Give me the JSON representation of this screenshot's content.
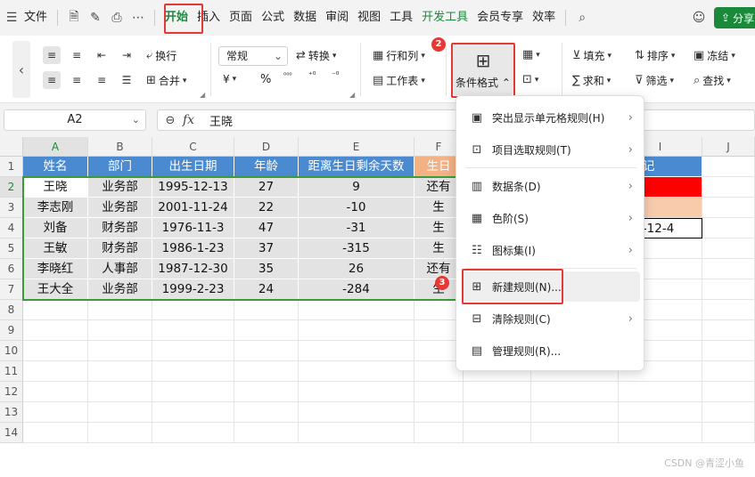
{
  "menubar": {
    "file": "文件",
    "tabs": [
      "开始",
      "插入",
      "页面",
      "公式",
      "数据",
      "审阅",
      "视图",
      "工具",
      "开发工具",
      "会员专享",
      "效率"
    ],
    "share": "分享"
  },
  "ribbon": {
    "wrap": "换行",
    "merge": "合并",
    "number_format": "常规",
    "convert": "转换",
    "rows_cols": "行和列",
    "worksheet": "工作表",
    "cond_format": "条件格式",
    "fill": "填充",
    "sort": "排序",
    "freeze": "冻结",
    "sum": "求和",
    "filter": "筛选",
    "find": "查找",
    "currency": "¥",
    "percent": "%"
  },
  "badges": [
    "1",
    "2",
    "3"
  ],
  "formula_bar": {
    "name_box": "A2",
    "fx": "fx",
    "value": "王晓"
  },
  "columns": [
    "A",
    "B",
    "C",
    "D",
    "E",
    "F",
    "G",
    "H",
    "I",
    "J"
  ],
  "rows": [
    "1",
    "2",
    "3",
    "4",
    "5",
    "6",
    "7",
    "8",
    "9",
    "10",
    "11",
    "12",
    "13",
    "14"
  ],
  "table": {
    "headers": [
      "姓名",
      "部门",
      "出生日期",
      "年龄",
      "距离生日剩余天数",
      "生日"
    ],
    "rows": [
      [
        "王晓",
        "业务部",
        "1995-12-13",
        "27",
        "9",
        "还有"
      ],
      [
        "李志刚",
        "业务部",
        "2001-11-24",
        "22",
        "-10",
        "生"
      ],
      [
        "刘备",
        "财务部",
        "1976-11-3",
        "47",
        "-31",
        "生"
      ],
      [
        "王敏",
        "财务部",
        "1986-1-23",
        "37",
        "-315",
        "生"
      ],
      [
        "李晓红",
        "人事部",
        "1987-12-30",
        "35",
        "26",
        "还有"
      ],
      [
        "王大全",
        "业务部",
        "1999-2-23",
        "24",
        "-284",
        "生"
      ]
    ],
    "i_header": "色标记",
    "i4_value": "023-12-4"
  },
  "dropdown": {
    "items": [
      {
        "label": "突出显示单元格规则(H)",
        "icon": "highlight-rules-icon",
        "arrow": true
      },
      {
        "label": "项目选取规则(T)",
        "icon": "top-bottom-icon",
        "arrow": true
      },
      {
        "label": "数据条(D)",
        "icon": "data-bar-icon",
        "arrow": true
      },
      {
        "label": "色阶(S)",
        "icon": "color-scale-icon",
        "arrow": true
      },
      {
        "label": "图标集(I)",
        "icon": "icon-set-icon",
        "arrow": true
      },
      {
        "label": "新建规则(N)...",
        "icon": "new-rule-icon",
        "arrow": false
      },
      {
        "label": "清除规则(C)",
        "icon": "clear-rule-icon",
        "arrow": true
      },
      {
        "label": "管理规则(R)...",
        "icon": "manage-rule-icon",
        "arrow": false
      }
    ]
  },
  "watermark": "CSDN @青涩小鱼",
  "colors": {
    "accent": "#1a8a3a",
    "header_blue": "#4a8ad0",
    "header_orange": "#f4b183",
    "red_mark": "#ff0000",
    "peach_mark": "#f8cbad",
    "annotation_red": "#e53935"
  }
}
